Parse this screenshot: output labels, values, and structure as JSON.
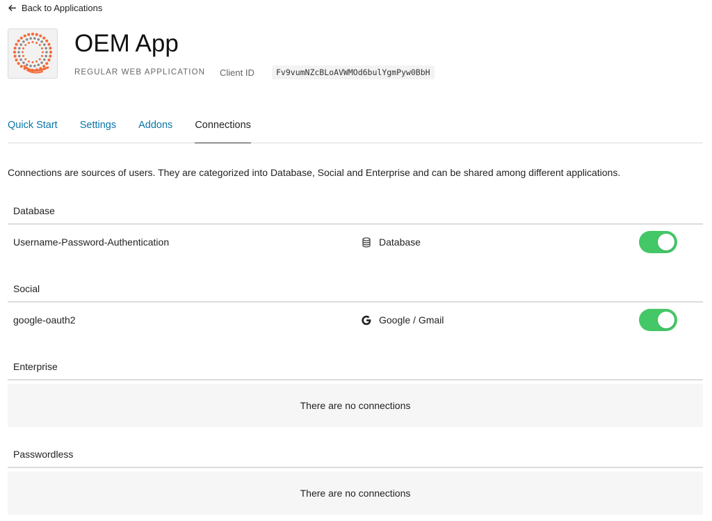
{
  "nav": {
    "back_label": "Back to Applications"
  },
  "app": {
    "title": "OEM App",
    "type": "REGULAR WEB APPLICATION",
    "client_id_label": "Client ID",
    "client_id": "Fv9vumNZcBLoAVWMOd6bulYgmPyw0BbH"
  },
  "tabs": [
    {
      "label": "Quick Start",
      "active": false
    },
    {
      "label": "Settings",
      "active": false
    },
    {
      "label": "Addons",
      "active": false
    },
    {
      "label": "Connections",
      "active": true
    }
  ],
  "description": "Connections are sources of users. They are categorized into Database, Social and Enterprise and can be shared among different applications.",
  "sections": {
    "database": {
      "title": "Database",
      "rows": [
        {
          "name": "Username-Password-Authentication",
          "type": "Database",
          "icon": "database-icon",
          "enabled": true
        }
      ]
    },
    "social": {
      "title": "Social",
      "rows": [
        {
          "name": "google-oauth2",
          "type": "Google / Gmail",
          "icon": "google-icon",
          "enabled": true
        }
      ]
    },
    "enterprise": {
      "title": "Enterprise",
      "empty_text": "There are no connections"
    },
    "passwordless": {
      "title": "Passwordless",
      "empty_text": "There are no connections"
    }
  },
  "colors": {
    "link": "#0a74a8",
    "toggle_on": "#44c767",
    "logo_orange": "#f26b3a",
    "logo_gray": "#8a8a8a"
  }
}
